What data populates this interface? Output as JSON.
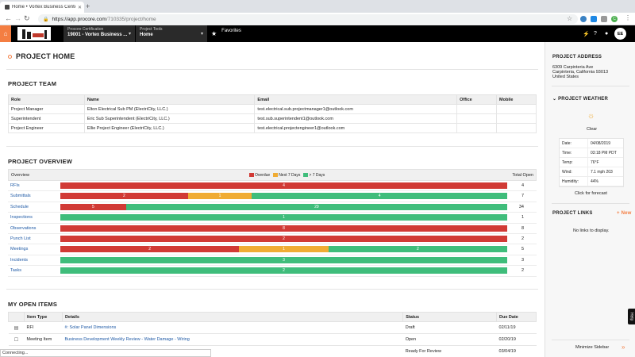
{
  "browser": {
    "tab_title": "Home • Vortex Business Cente",
    "url_host": "https://app.procore.com",
    "url_path": "/710335/project/home",
    "ext_letter": "C"
  },
  "header": {
    "company_label": "Procore Certification",
    "project_value": "19001 - Vortex Business ...",
    "tools_label": "Project Tools",
    "tools_value": "Home",
    "favorites_label": "Favorites",
    "avatar_initials": "EE"
  },
  "page_title": "PROJECT HOME",
  "team": {
    "title": "PROJECT TEAM",
    "columns": [
      "Role",
      "Name",
      "Email",
      "Office",
      "Mobile"
    ],
    "rows": [
      [
        "Project Manager",
        "Elton Electrical Sub PM (ElectriCity, LLC.)",
        "test.electrical.sub.projectmanager1@outlook.com",
        "",
        ""
      ],
      [
        "Superintendent",
        "Eric Sub Superintendent (ElectriCity, LLC.)",
        "test.sub.superintendent1@outlook.com",
        "",
        ""
      ],
      [
        "Project Engineer",
        "Ellie Project Engineer (ElectriCity, LLC.)",
        "test.electrical.projectengineer1@outlook.com",
        "",
        ""
      ]
    ]
  },
  "overview": {
    "title": "PROJECT OVERVIEW",
    "col_overview": "Overview",
    "col_total": "Total Open",
    "legend": [
      "Overdue",
      "Next 7 Days",
      "> 7 Days"
    ],
    "colors": {
      "overdue": "#d13a35",
      "next7": "#f0ac34",
      "gt7": "#3fbd7b"
    },
    "rows": [
      {
        "name": "RFIs",
        "overdue": 4,
        "next7": 0,
        "gt7": 0,
        "total": "4"
      },
      {
        "name": "Submittals",
        "overdue": 2,
        "next7": 1,
        "gt7": 4,
        "total": "7"
      },
      {
        "name": "Schedule",
        "overdue": 5,
        "next7": 0,
        "gt7": 29,
        "total": "34"
      },
      {
        "name": "Inspections",
        "overdue": 0,
        "next7": 0,
        "gt7": 1,
        "total": "1"
      },
      {
        "name": "Observations",
        "overdue": 8,
        "next7": 0,
        "gt7": 0,
        "total": "8"
      },
      {
        "name": "Punch List",
        "overdue": 2,
        "next7": 0,
        "gt7": 0,
        "total": "2"
      },
      {
        "name": "Meetings",
        "overdue": 2,
        "next7": 1,
        "gt7": 2,
        "total": "5"
      },
      {
        "name": "Incidents",
        "overdue": 0,
        "next7": 0,
        "gt7": 3,
        "total": "3"
      },
      {
        "name": "Tasks",
        "overdue": 0,
        "next7": 0,
        "gt7": 2,
        "total": "2"
      }
    ]
  },
  "open_items": {
    "title": "MY OPEN ITEMS",
    "columns": [
      "",
      "Item Type",
      "Details",
      "Status",
      "Due Date"
    ],
    "rows": [
      {
        "icon": "document-icon",
        "type": "RFI",
        "details": "#: Solar Panel Dimensions",
        "status": "Draft",
        "due": "02/11/19"
      },
      {
        "icon": "checkbox-icon",
        "type": "Meeting Item",
        "details": "Business Development Weekly Review - Water Damage - Wiring",
        "status": "Open",
        "due": "02/20/19"
      },
      {
        "icon": "checkbox-icon",
        "type": "",
        "details": "",
        "status": "Ready For Review",
        "due": "03/04/19"
      }
    ]
  },
  "sidebar": {
    "address_title": "PROJECT ADDRESS",
    "address_lines": [
      "6309 Carpinteria Ave",
      "Carpinteria, California 93013",
      "United States"
    ],
    "weather_title": "PROJECT WEATHER",
    "weather_cond": "Clear",
    "weather_rows": [
      {
        "k": "Date:",
        "v": "04/08/2019"
      },
      {
        "k": "Time:",
        "v": "03:18 PM PDT"
      },
      {
        "k": "Temp:",
        "v": "76°F"
      },
      {
        "k": "Wind:",
        "v": "7.1 mph 203"
      },
      {
        "k": "Humidity:",
        "v": "44%"
      }
    ],
    "forecast_link": "Click for forecast",
    "links_title": "PROJECT LINKS",
    "links_new": "+ New",
    "links_empty": "No links to display.",
    "minimize": "Minimize Sidebar",
    "help": "Help"
  },
  "status_text": "Connecting..."
}
